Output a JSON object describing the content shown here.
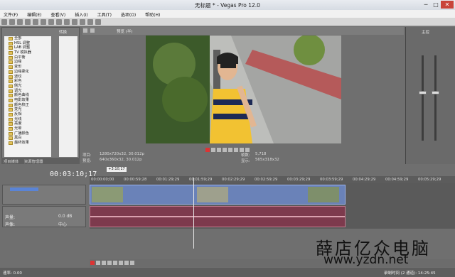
{
  "window": {
    "title": "无标题 * - Vegas Pro 12.0"
  },
  "menu": [
    "文件(F)",
    "编辑(E)",
    "查看(V)",
    "插入(I)",
    "工具(T)",
    "选项(O)",
    "帮助(H)"
  ],
  "explorer": {
    "header": "转换",
    "items": [
      "全部",
      "HSL 调整",
      "LAB 调整",
      "TV 模拟器",
      "白平衡",
      "边缘",
      "变形",
      "边缘柔化",
      "波纹",
      "彩色",
      "侧光",
      "调光",
      "颜色曲线",
      "电影效果",
      "颜色校正",
      "变光",
      "反相",
      "光线",
      "亮度",
      "光晕",
      "广播颜色",
      "黑白",
      "最终效果"
    ],
    "tabs": [
      "项目媒体",
      "资源管理器"
    ]
  },
  "preview": {
    "mode": "预览 (半)",
    "project_label": "项目:",
    "project_value": "1280x720x32, 30.012p",
    "preview_label": "预览:",
    "preview_value": "640x360x32, 30.012p",
    "frame_label": "帧数:",
    "frame_value": "5,718",
    "display_label": "显示:",
    "display_value": "565x318x32"
  },
  "timeline": {
    "current_time": "00:03:10;17",
    "cursor_mark": "+3:10;17",
    "ruler_ticks": [
      "00:00:00;00",
      "00:00:59;28",
      "00:01:29;29",
      "00:01:59;29",
      "00:02:29;29",
      "00:02:59;29",
      "00:03:29;29",
      "00:03:59;29",
      "00:04:29;29",
      "00:04:59;29",
      "00:05:29;29"
    ],
    "audio_level": "声量:",
    "audio_pan": "声像:",
    "audio_db": "0.0 dB",
    "audio_center": "中心"
  },
  "status": {
    "rate": "速率: 0.00",
    "record_time": "录制时间 (2 通道): 14:25:45"
  },
  "watermark": {
    "cn": "薛店亿众电脑",
    "url": "www.yzdn.net"
  },
  "mixer": {
    "title": "主控"
  }
}
